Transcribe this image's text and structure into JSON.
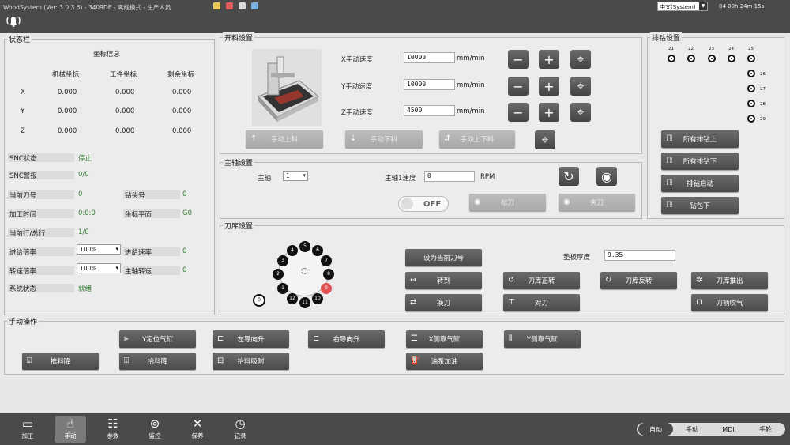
{
  "title": "WoodSystem (Ver: 3.0.3.6) - 3409DE - 离线模式 - 生产人员",
  "language": "中文(System)",
  "runtime": "04 00h 24m 15s",
  "status_panel": {
    "title": "状态栏",
    "coord_title": "坐标信息",
    "headers": [
      "机械坐标",
      "工件坐标",
      "剩余坐标"
    ],
    "rows": [
      {
        "axis": "X",
        "values": [
          "0.000",
          "0.000",
          "0.000"
        ]
      },
      {
        "axis": "Y",
        "values": [
          "0.000",
          "0.000",
          "0.000"
        ]
      },
      {
        "axis": "Z",
        "values": [
          "0.000",
          "0.000",
          "0.000"
        ]
      }
    ],
    "snc_state_label": "SNC状态",
    "snc_state": "停止",
    "snc_alarm_label": "SNC警报",
    "snc_alarm": "0/0",
    "cur_tool_label": "当前刀号",
    "cur_tool": "0",
    "drill_no_label": "钻头号",
    "drill_no": "0",
    "proc_time_label": "加工时间",
    "proc_time": "0:0:0",
    "coord_plane_label": "坐标平面",
    "coord_plane": "G0",
    "cur_line_label": "当前行/总行",
    "cur_line": "1/0",
    "feed_rate_label": "进给倍率",
    "feed_rate": "100%",
    "feed_speed_label": "进给速率",
    "feed_speed": "0",
    "spindle_rate_label": "转速倍率",
    "spindle_rate": "100%",
    "spindle_speed_label": "主轴转速",
    "spindle_speed": "0",
    "sys_state_label": "系统状态",
    "sys_state": "就绪"
  },
  "feed_panel": {
    "title": "开料设置",
    "x_label": "X手动速度",
    "x_value": "10000",
    "y_label": "Y手动速度",
    "y_value": "10000",
    "z_label": "Z手动速度",
    "z_value": "4500",
    "unit": "mm/min",
    "manual_load": "手动上料",
    "manual_unload": "手动下料",
    "manual_load_unload": "手动上下料"
  },
  "drill_panel": {
    "title": "排钻设置",
    "top_numbers": [
      "21",
      "22",
      "23",
      "24",
      "25"
    ],
    "side_numbers": [
      "26",
      "27",
      "28",
      "29"
    ],
    "all_up": "所有排钻上",
    "all_down": "所有排钻下",
    "drill_start": "排钻启动",
    "drill_pack_down": "钻包下"
  },
  "spindle_panel": {
    "title": "主轴设置",
    "spindle_label": "主轴",
    "spindle_select": "1",
    "speed_label": "主轴1速度",
    "speed_value": "0",
    "speed_unit": "RPM",
    "toggle": "OFF",
    "loosen": "松刀",
    "clamp": "夹刀"
  },
  "magazine_panel": {
    "title": "刀库设置",
    "tools": [
      "1",
      "2",
      "3",
      "4",
      "5",
      "6",
      "7",
      "8",
      "9",
      "10",
      "11",
      "12",
      "0"
    ],
    "set_current": "设为当前刀号",
    "pad_label": "垫板厚度",
    "pad_value": "9.35",
    "rotate_to": "转到",
    "change_tool": "换刀",
    "fwd": "刀库正转",
    "align": "对刀",
    "rev": "刀库反转",
    "push_out": "刀库推出",
    "blow": "刀柄吹气"
  },
  "manual_panel": {
    "title": "手动操作",
    "y_cyl": "Y定位气缸",
    "left_guide": "左导向升",
    "right_guide": "右导向升",
    "x_side": "X侧靠气缸",
    "y_side": "Y侧靠气缸",
    "push_down": "推料降",
    "lift_down": "抬料降",
    "suction": "抬料吸附",
    "oil": "油泵加油"
  },
  "nav": [
    {
      "label": "加工",
      "icon": "monitor-icon"
    },
    {
      "label": "手动",
      "icon": "hand-icon"
    },
    {
      "label": "参数",
      "icon": "sliders-icon"
    },
    {
      "label": "监控",
      "icon": "monitor-dots-icon"
    },
    {
      "label": "保养",
      "icon": "tools-icon"
    },
    {
      "label": "记录",
      "icon": "clock-icon"
    }
  ],
  "modes": [
    "自动",
    "手动",
    "MDI",
    "手轮"
  ],
  "active_mode": "自动",
  "active_nav": "手动"
}
